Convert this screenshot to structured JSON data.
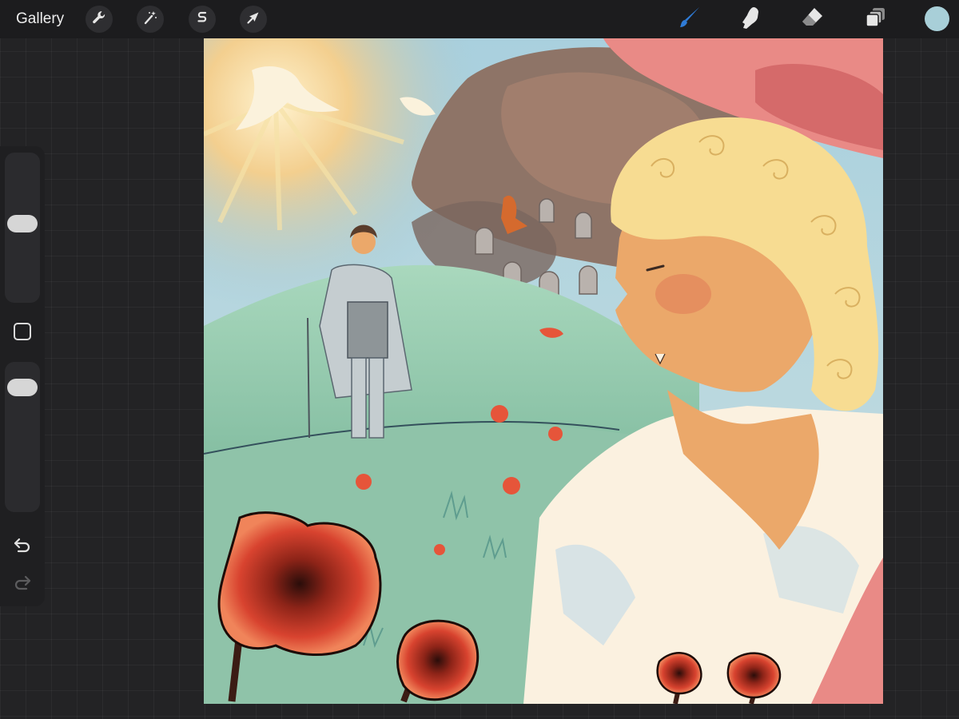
{
  "topbar": {
    "gallery_label": "Gallery",
    "left_tools": [
      {
        "name": "actions",
        "icon": "wrench-icon"
      },
      {
        "name": "adjustments",
        "icon": "magic-wand-icon"
      },
      {
        "name": "selection",
        "icon": "selection-s-icon"
      },
      {
        "name": "transform",
        "icon": "arrow-cursor-icon"
      }
    ],
    "right_tools": [
      {
        "name": "brush",
        "icon": "brush-icon",
        "active": true
      },
      {
        "name": "smudge",
        "icon": "smudge-finger-icon"
      },
      {
        "name": "eraser",
        "icon": "eraser-icon"
      },
      {
        "name": "layers",
        "icon": "layers-icon"
      }
    ],
    "current_color": "#a8cfd8",
    "active_color": "#2f7bd6"
  },
  "sidebar": {
    "brush_size_level": 0.53,
    "opacity_level": 0.89,
    "buttons": [
      {
        "name": "modify",
        "icon": "square-outline-icon"
      },
      {
        "name": "undo",
        "icon": "undo-arrow-icon"
      },
      {
        "name": "redo",
        "icon": "redo-arrow-icon",
        "disabled": true
      }
    ]
  },
  "canvas": {
    "artwork": "painting",
    "palette": {
      "sky": "#9fc7d6",
      "sun": "#f3cf8f",
      "smoke": "#8e7467",
      "hill": "#9ccfb0",
      "skin": "#eba86a",
      "hair": "#f7dc92",
      "shirt": "#fbf1e0",
      "hat": "#e98a86",
      "poppy": "#d8432f"
    }
  }
}
